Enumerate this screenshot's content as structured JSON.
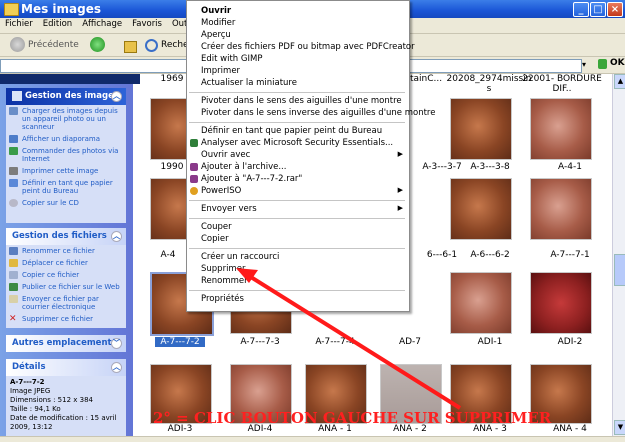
{
  "window": {
    "title": "Mes images"
  },
  "menubar": [
    "Fichier",
    "Edition",
    "Affichage",
    "Favoris",
    "Outils"
  ],
  "toolbar": {
    "back": "Précédente",
    "search": "Reche"
  },
  "address": {
    "go": "OK"
  },
  "taskpane": {
    "images": {
      "title": "Gestion des images",
      "items": [
        "Charger des images depuis un appareil photo ou un scanneur",
        "Afficher un diaporama",
        "Commander des photos via Internet",
        "Imprimer cette image",
        "Définir en tant que papier peint du Bureau",
        "Copier sur le CD"
      ]
    },
    "files": {
      "title": "Gestion des fichiers",
      "items": [
        "Renommer ce fichier",
        "Déplacer ce fichier",
        "Copier ce fichier",
        "Publier ce fichier sur le Web",
        "Envoyer ce fichier par courrier électronique",
        "Supprimer ce fichier"
      ]
    },
    "places": {
      "title": "Autres emplacements"
    },
    "details": {
      "title": "Détails",
      "name": "A-7---7-2",
      "type": "Image JPEG",
      "dimensions": "Dimensions : 512 x 384",
      "size": "Taille : 94,1 Ko",
      "date": "Date de modification : 15 avril 2009, 13:12"
    }
  },
  "grid": {
    "top_labels": [
      "1969",
      "tetainC...",
      "20208_2974missin s",
      "22001- BORDURE DIF.."
    ],
    "row1_labels": [
      "1990",
      "A-3---3-7",
      "A-3---3-8",
      "A-4-1"
    ],
    "row2_labels": [
      "A-4",
      "6---6-1",
      "A-6---6-2",
      "A-7---7-1"
    ],
    "row3_labels": [
      "A-7---7-2",
      "A-7---7-3",
      "A-7---7-4",
      "AD-7",
      "ADI-1",
      "ADI-2"
    ],
    "row4_labels": [
      "ADI-3",
      "ADI-4",
      "ANA - 1",
      "ANA - 2",
      "ANA - 3",
      "ANA - 4"
    ]
  },
  "context_menu": {
    "items": [
      "Ouvrir",
      "Modifier",
      "Aperçu",
      "Créer des fichiers PDF ou bitmap avec PDFCreator",
      "Edit with GIMP",
      "Imprimer",
      "Actualiser la miniature",
      "Pivoter dans le sens des aiguilles d'une montre",
      "Pivoter dans le sens inverse des aiguilles d'une montre",
      "Définir en tant que papier peint du Bureau",
      "Analyser avec Microsoft Security Essentials...",
      "Ouvrir avec",
      "Ajouter à l'archive...",
      "Ajouter à \"A-7---7-2.rar\"",
      "PowerISO",
      "Envoyer vers",
      "Couper",
      "Copier",
      "Créer un raccourci",
      "Supprimer",
      "Renommer",
      "Propriétés"
    ]
  },
  "annotation": "2° = CLIC BOUTON GAUCHE SUR SUPPRIMER",
  "colors": {
    "titlebar": "#1a55d6",
    "annotation": "#ff2020",
    "taskpane": "#6f8ee0"
  }
}
